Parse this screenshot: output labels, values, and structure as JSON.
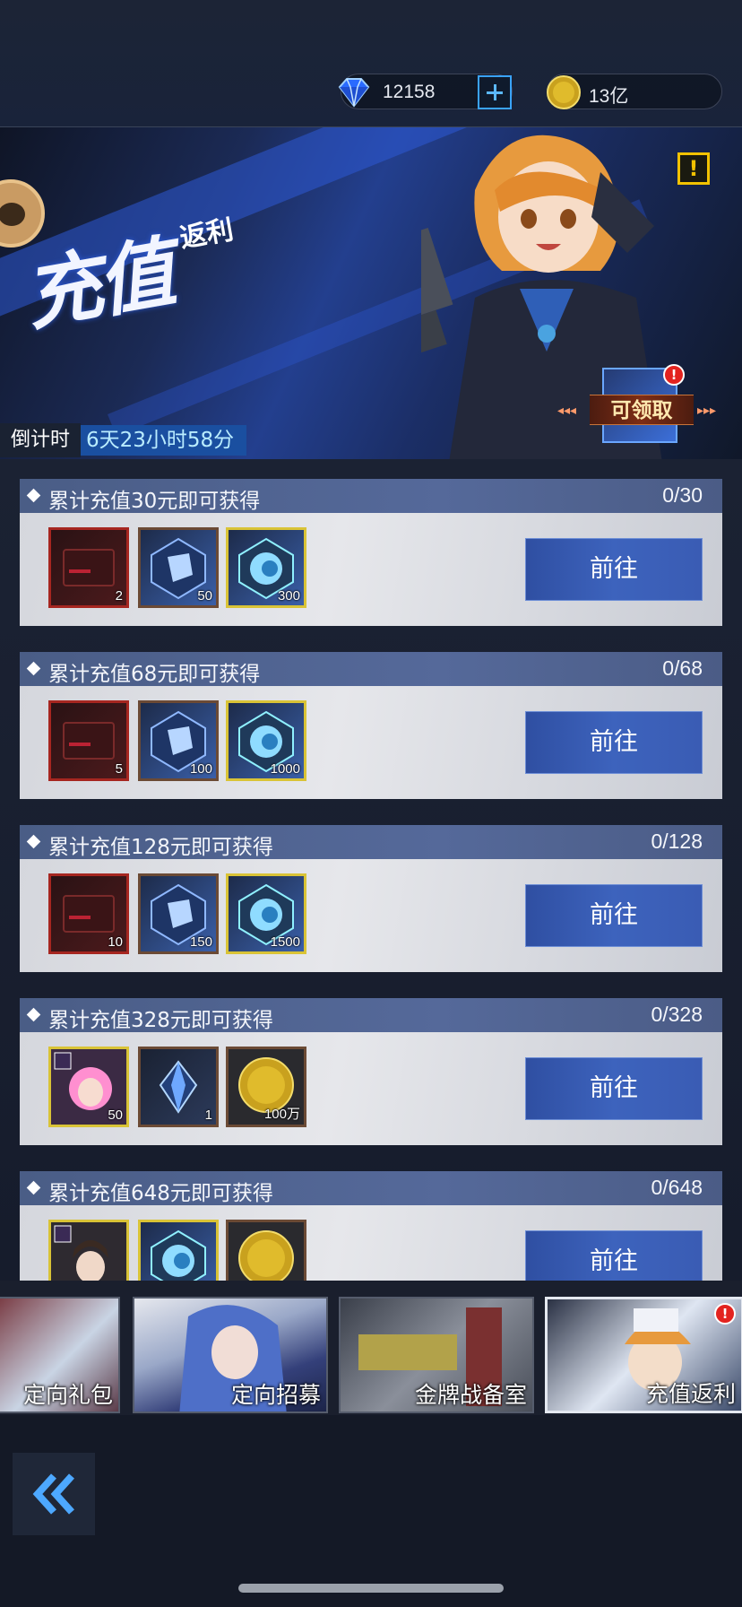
{
  "header": {
    "diamond_amount": "12158",
    "gold_amount": "13亿"
  },
  "banner": {
    "title": "充值",
    "subtitle": "返利",
    "countdown_label": "倒计时",
    "countdown_value": "6天23小时58分",
    "claim_label": "可领取",
    "alert_symbol": "!",
    "badge_symbol": "!"
  },
  "rewards": [
    {
      "title": "累计充值30元即可获得",
      "progress": "0/30",
      "button": "前往",
      "items": [
        {
          "icon": "red-card-icon",
          "qty": "2"
        },
        {
          "icon": "blue-crystal-icon",
          "qty": "50"
        },
        {
          "icon": "gem-orb-icon",
          "qty": "300"
        }
      ]
    },
    {
      "title": "累计充值68元即可获得",
      "progress": "0/68",
      "button": "前往",
      "items": [
        {
          "icon": "red-card-icon",
          "qty": "5"
        },
        {
          "icon": "blue-crystal-icon",
          "qty": "100"
        },
        {
          "icon": "gem-orb-icon",
          "qty": "1000"
        }
      ]
    },
    {
      "title": "累计充值128元即可获得",
      "progress": "0/128",
      "button": "前往",
      "items": [
        {
          "icon": "red-card-icon",
          "qty": "10"
        },
        {
          "icon": "blue-crystal-icon",
          "qty": "150"
        },
        {
          "icon": "gem-orb-icon",
          "qty": "1500"
        }
      ]
    },
    {
      "title": "累计充值328元即可获得",
      "progress": "0/328",
      "button": "前往",
      "items": [
        {
          "icon": "character-shard-icon",
          "qty": "50"
        },
        {
          "icon": "dark-crystal-icon",
          "qty": "1"
        },
        {
          "icon": "gold-coin-icon",
          "qty": "100万"
        }
      ]
    },
    {
      "title": "累计充值648元即可获得",
      "progress": "0/648",
      "button": "前往",
      "items": [
        {
          "icon": "character-shard-icon",
          "qty": ""
        },
        {
          "icon": "gem-orb-icon",
          "qty": ""
        },
        {
          "icon": "gold-coin-icon",
          "qty": ""
        }
      ]
    }
  ],
  "tabs": [
    {
      "label": "定向礼包",
      "active": false
    },
    {
      "label": "定向招募",
      "active": false
    },
    {
      "label": "金牌战备室",
      "active": false
    },
    {
      "label": "充值返利",
      "active": true,
      "badge": "!"
    }
  ],
  "footer": {
    "back_icon": "double-chevron-left-icon"
  },
  "colors": {
    "accent_blue": "#3d63bd",
    "header_bar": "#55699a",
    "alert_yellow": "#f2c200",
    "badge_red": "#e3231f"
  }
}
